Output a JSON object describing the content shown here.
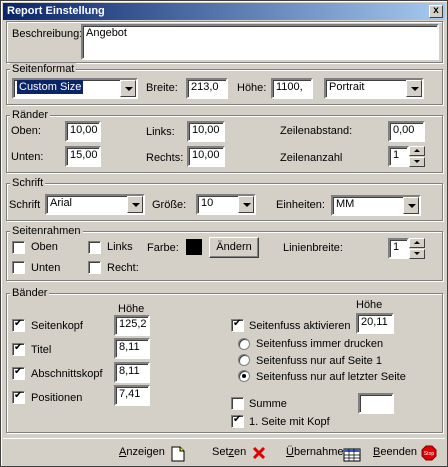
{
  "window": {
    "title": "Report Einstellung",
    "close_glyph": "x"
  },
  "beschreibung": {
    "label": "Beschreibung:",
    "value": "Angebot"
  },
  "seitenformat": {
    "legend": "Seitenformat",
    "size_selected": "Custom Size",
    "breite_label": "Breite:",
    "breite_value": "213,0",
    "hoehe_label": "Höhe:",
    "hoehe_value": "1100,",
    "orientation_selected": "Portrait"
  },
  "raender": {
    "legend": "Ränder",
    "oben_label": "Oben:",
    "oben_value": "10,00",
    "unten_label": "Unten:",
    "unten_value": "15,00",
    "links_label": "Links:",
    "links_value": "10,00",
    "rechts_label": "Rechts:",
    "rechts_value": "10,00",
    "zeilenabstand_label": "Zeilenabstand:",
    "zeilenabstand_value": "0,00",
    "zeilenanzahl_label": "Zeilenanzahl",
    "zeilenanzahl_value": "1"
  },
  "schrift": {
    "legend": "Schrift",
    "schrift_label": "Schrift",
    "schrift_value": "Arial",
    "groesse_label": "Größe:",
    "groesse_value": "10",
    "einheiten_label": "Einheiten:",
    "einheiten_value": "MM"
  },
  "seitenrahmen": {
    "legend": "Seitenrahmen",
    "oben": "Oben",
    "unten": "Unten",
    "links": "Links",
    "recht": "Recht:",
    "farbe_label": "Farbe:",
    "farbe_color": "#000000",
    "aendern_button": "Ändern",
    "linienbreite_label": "Linienbreite:",
    "linienbreite_value": "1"
  },
  "baender": {
    "legend": "Bänder",
    "hoehe_header_left": "Höhe",
    "hoehe_header_right": "Höhe",
    "rows": [
      {
        "label": "Seitenkopf",
        "value": "125,2",
        "checked": true
      },
      {
        "label": "Titel",
        "value": "8,11",
        "checked": true
      },
      {
        "label": "Abschnittskopf",
        "value": "8,11",
        "checked": true
      },
      {
        "label": "Positionen",
        "value": "7,41",
        "checked": true
      }
    ],
    "seitenfuss_label": "Seitenfuss aktivieren",
    "seitenfuss_value": "20,11",
    "radio_options": [
      {
        "label": "Seitenfuss immer drucken",
        "checked": false
      },
      {
        "label": "Seitenfuss nur auf Seite 1",
        "checked": false
      },
      {
        "label": "Seitenfuss nur auf letzter Seite",
        "checked": true
      }
    ],
    "summe_label": "Summe",
    "summe_value": "",
    "erste_seite_label": "1. Seite mit Kopf"
  },
  "footer": {
    "anzeigen_underlined": "A",
    "anzeigen_rest": "nzeigen",
    "setzen_pre": "Set",
    "setzen_underlined": "z",
    "setzen_rest": "en",
    "uebernahme_underlined": "Ü",
    "uebernahme_rest": "bernahme",
    "beenden_underlined": "B",
    "beenden_rest": "eenden",
    "stop_icon_text": "Stop"
  },
  "colors": {
    "titlebar_start": "#0a246a",
    "titlebar_end": "#a6caf0",
    "face": "#d4d0c8",
    "selection": "#0a246a"
  },
  "icons": [
    "close-icon",
    "dropdown-arrow-icon",
    "spin-up-icon",
    "spin-down-icon",
    "document-icon",
    "red-x-icon",
    "table-icon",
    "stop-icon"
  ]
}
